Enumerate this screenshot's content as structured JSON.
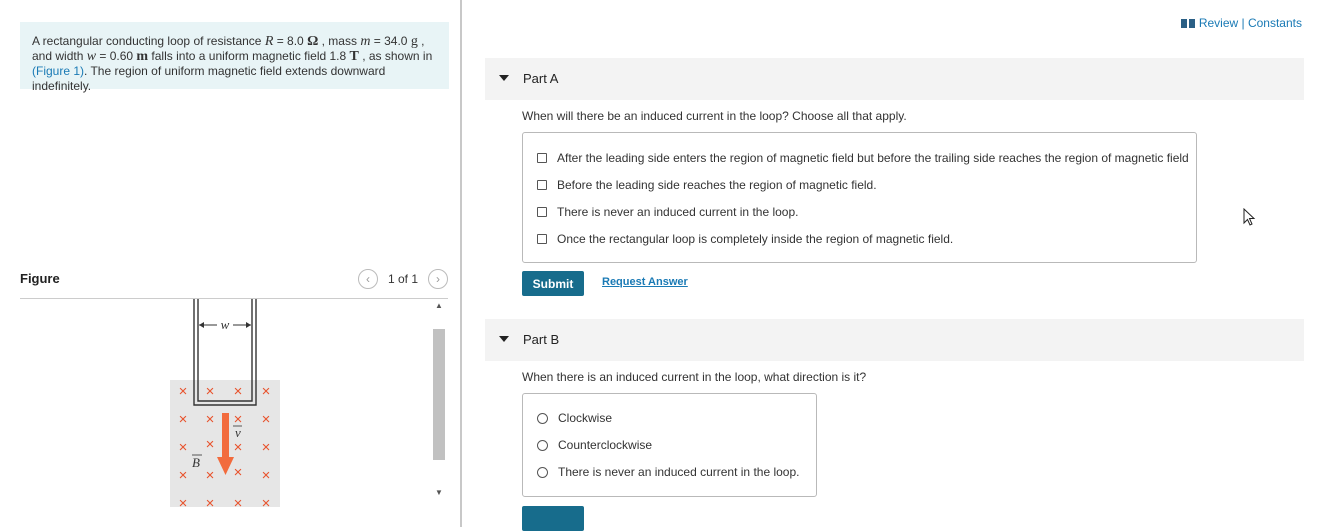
{
  "problem": {
    "seg1": "A rectangular conducting loop of resistance ",
    "R_sym": "R",
    "seg2": " = 8.0 ",
    "R_unit": "Ω",
    "seg3": " , mass ",
    "m_sym": "m",
    "seg4": " = 34.0 ",
    "m_unit": "g",
    "seg5": " , and width ",
    "w_sym": "w",
    "seg6": " = 0.60 ",
    "w_unit": "m",
    "seg7": " falls into a uniform magnetic field 1.8 ",
    "B_unit": "T",
    "seg8": " , as shown in ",
    "figure_link": "(Figure 1)",
    "seg9": ". The region of uniform magnetic field extends downward indefinitely."
  },
  "figure_panel": {
    "title": "Figure",
    "pager_text": "1 of 1",
    "prev_icon": "chevron-left-icon",
    "next_icon": "chevron-right-icon",
    "labels": {
      "width": "w",
      "velocity": "v",
      "field": "B",
      "cross": "×"
    },
    "colors": {
      "cross": "#e8532d",
      "arrow": "#f26b3d",
      "field_bg": "#e6e6e6",
      "loop": "#333333"
    }
  },
  "header": {
    "review_constants": "Review | Constants",
    "icon": "book-icon"
  },
  "partA": {
    "label": "Part A",
    "question": "When will there be an induced current in the loop? Choose all that apply.",
    "options": [
      "After the leading side enters the region of magnetic field but before the trailing side reaches the region of magnetic field",
      "Before the leading side reaches the region of magnetic field.",
      "There is never an induced current in the loop.",
      "Once the rectangular loop is completely inside the region of magnetic field."
    ],
    "submit_label": "Submit",
    "request_answer_label": "Request Answer"
  },
  "partB": {
    "label": "Part B",
    "question": "When there is an induced current in the loop, what direction is it?",
    "options": [
      "Clockwise",
      "Counterclockwise",
      "There is never an induced current in the loop."
    ]
  }
}
